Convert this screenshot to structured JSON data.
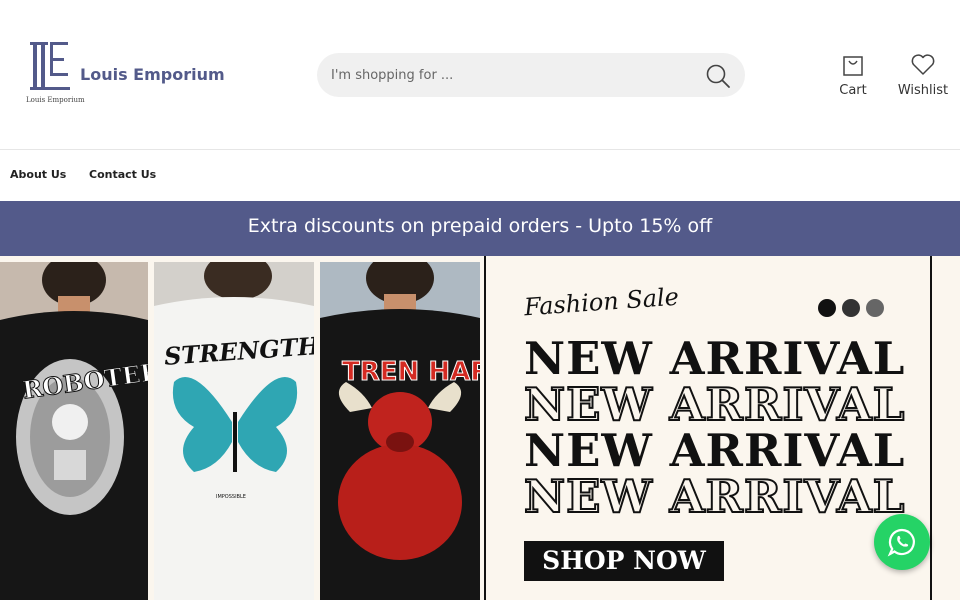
{
  "brand": {
    "name": "Louis Emporium",
    "sub": "Louis Emporium",
    "accent": "#535a8a"
  },
  "search": {
    "placeholder": "I'm shopping for ..."
  },
  "header": {
    "cart_label": "Cart",
    "wishlist_label": "Wishlist"
  },
  "nav": {
    "items": [
      {
        "label": "About Us"
      },
      {
        "label": "Contact Us"
      }
    ]
  },
  "announcement": {
    "text": "Extra discounts on prepaid orders - Upto 15% off"
  },
  "hero": {
    "script_title": "Fashion Sale",
    "headline": "NEW ARRIVAL",
    "cta": "SHOP NOW",
    "slider_dots": [
      "#111111",
      "#333333",
      "#666666"
    ],
    "shirts": [
      {
        "print_text": "ROBOTER",
        "color": "#1a1a1a"
      },
      {
        "print_text": "STRENGTH",
        "sub_text": "IMPOSSIBLE",
        "color": "#f2f2f2"
      },
      {
        "print_text": "TREN HARD",
        "color": "#1a1a1a"
      }
    ]
  },
  "icons": {
    "search": "search-icon",
    "cart": "shopping-bag-icon",
    "wishlist": "heart-icon",
    "chat": "whatsapp-icon"
  },
  "colors": {
    "whatsapp": "#25d366",
    "announce_bg": "#535a8a"
  }
}
